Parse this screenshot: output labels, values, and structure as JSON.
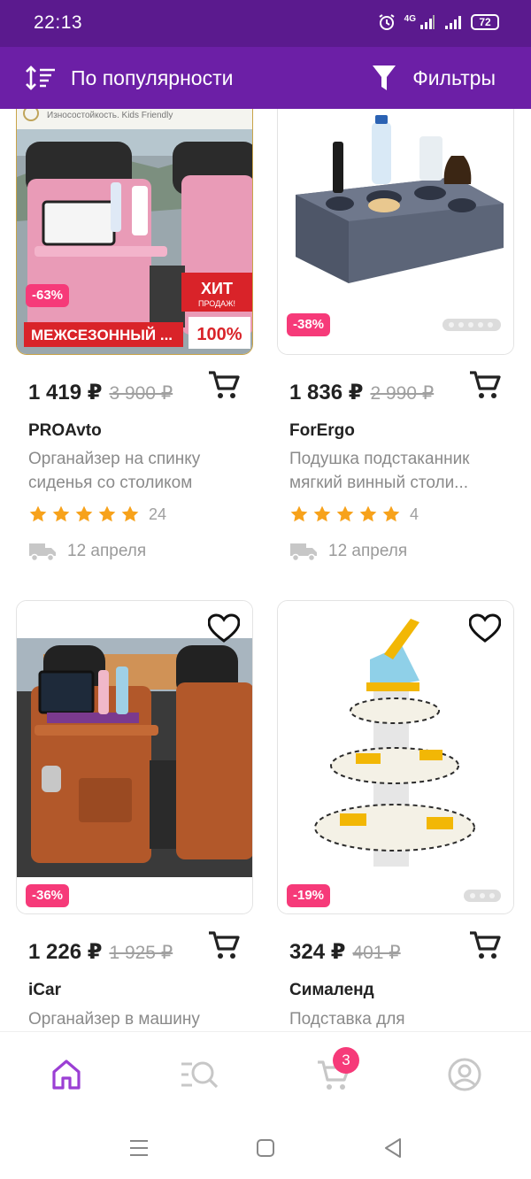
{
  "status_bar": {
    "time": "22:13",
    "network": "4G",
    "battery": "72"
  },
  "toolbar": {
    "sort_label": "По популярности",
    "filter_label": "Фильтры"
  },
  "products": [
    {
      "discount": "-63%",
      "price": "1 419 ₽",
      "old_price": "3 900 ₽",
      "brand": "PROAvto",
      "description": [
        "Органайзер на спинку",
        "сиденья со столиком"
      ],
      "rating_count": "24",
      "delivery": "12 апреля",
      "image_texts": {
        "top_banner": "Износостойкость. Kids Friendly",
        "hit_label": "ХИТ",
        "hit_sub": "ПРОДАЖ!",
        "season_banner": "МЕЖСЕЗОННЫЙ ...",
        "percent": "100%"
      }
    },
    {
      "discount": "-38%",
      "price": "1 836 ₽",
      "old_price": "2 990 ₽",
      "brand": "ForErgo",
      "description": [
        "Подушка подстаканник",
        "мягкий винный столи..."
      ],
      "rating_count": "4",
      "delivery": "12 апреля"
    },
    {
      "discount": "-36%",
      "price": "1 226 ₽",
      "old_price": "1 925 ₽",
      "brand": "iCar",
      "description": [
        "Органайзер в машину"
      ]
    },
    {
      "discount": "-19%",
      "price": "324 ₽",
      "old_price": "401 ₽",
      "brand": "Сималенд",
      "description": [
        "Подставка для"
      ]
    }
  ],
  "bottom_nav": {
    "cart_badge": "3",
    "items": [
      "home-icon",
      "catalog-search-icon",
      "cart-icon",
      "profile-icon"
    ]
  },
  "colors": {
    "header": "#6c1fa6",
    "status_bar": "#5b1a8e",
    "discount": "#f63a79",
    "star": "#f7a21b",
    "active_nav": "#9b3fd4"
  }
}
